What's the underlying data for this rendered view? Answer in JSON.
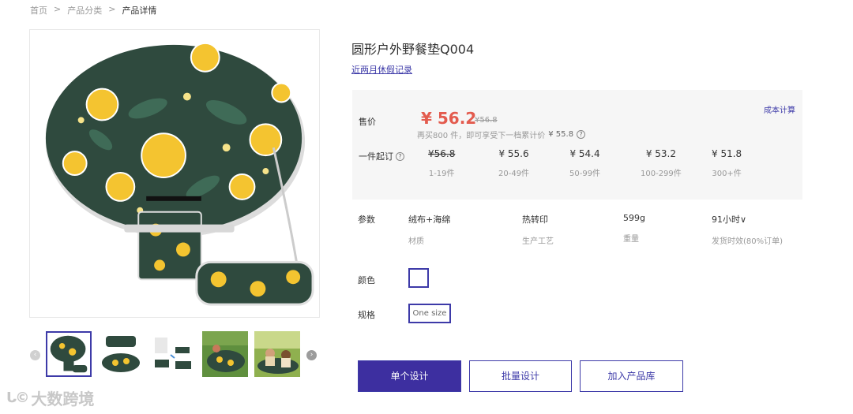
{
  "breadcrumb": {
    "home": "首页",
    "sep1": ">",
    "category": "产品分类",
    "sep2": ">",
    "current": "产品详情"
  },
  "product": {
    "title": "圆形户外野餐垫Q004",
    "holiday_link": "近两月休假记录"
  },
  "pricing": {
    "label": "售价",
    "current": "¥ 56.2",
    "original": "¥56.8",
    "cost_calc": "成本计算",
    "promo_text": "再买800 件，即可享受下一档累计价",
    "promo_price": "¥ 55.8",
    "tier_label": "一件起订",
    "tiers": [
      {
        "price": "¥56.8",
        "qty": "1-19件"
      },
      {
        "price": "¥ 55.6",
        "qty": "20-49件"
      },
      {
        "price": "¥ 54.4",
        "qty": "50-99件"
      },
      {
        "price": "¥ 53.2",
        "qty": "100-299件"
      },
      {
        "price": "¥ 51.8",
        "qty": "300+件"
      }
    ]
  },
  "params": {
    "label": "参数",
    "items": [
      {
        "value": "绒布+海绵",
        "key": "材质"
      },
      {
        "value": "热转印",
        "key": "生产工艺"
      },
      {
        "value": "599g",
        "key": "重量"
      },
      {
        "value": "91小时∨",
        "key": "发货时效(80%订单)"
      }
    ]
  },
  "color": {
    "label": "颜色",
    "selected": "#ffffff"
  },
  "spec": {
    "label": "规格",
    "option": "One size"
  },
  "actions": {
    "single": "单个设计",
    "bulk": "批量设计",
    "add_library": "加入产品库"
  },
  "watermark": {
    "logo": "ᒐ©",
    "text": "大数跨境"
  },
  "icons": {
    "question": "question-icon",
    "prev": "chevron-left-icon",
    "next": "chevron-right-icon"
  },
  "colors": {
    "accent": "#3d3aa8",
    "price_red": "#e35b4e",
    "mat_green": "#2f4a3e",
    "lemon_yellow": "#f4c430"
  }
}
